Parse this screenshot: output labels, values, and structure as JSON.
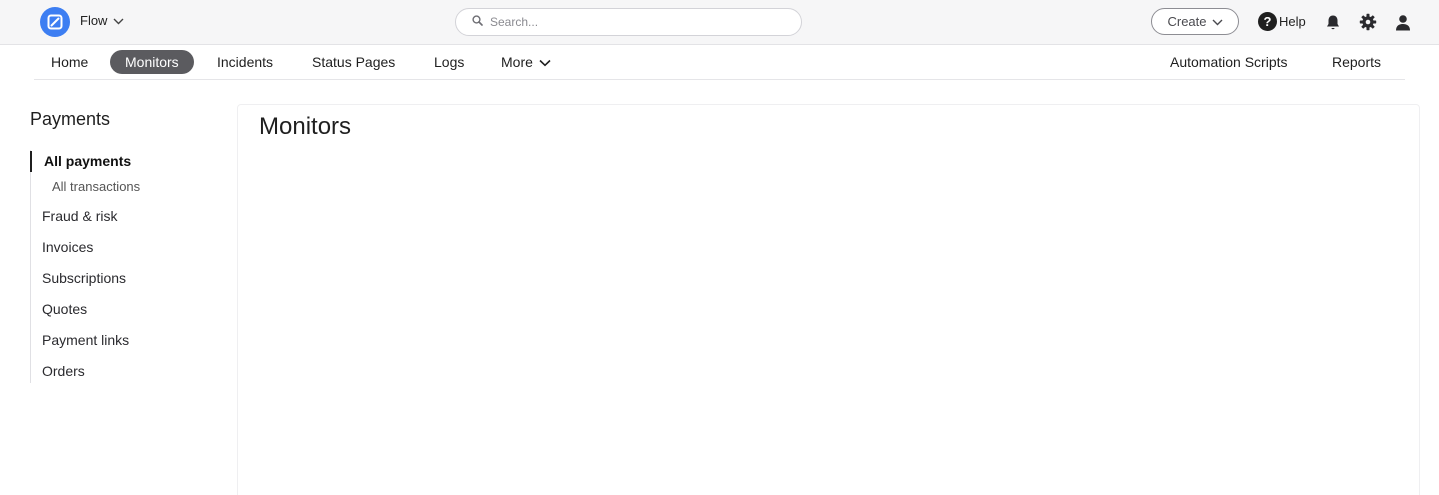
{
  "header": {
    "app_name": "Flow",
    "search_placeholder": "Search...",
    "create_label": "Create",
    "help_label": "Help",
    "help_glyph": "?"
  },
  "nav": {
    "items": [
      {
        "label": "Home"
      },
      {
        "label": "Monitors",
        "active": true
      },
      {
        "label": "Incidents"
      },
      {
        "label": "Status Pages"
      },
      {
        "label": "Logs"
      },
      {
        "label": "More"
      }
    ],
    "right_items": [
      {
        "label": "Automation Scripts"
      },
      {
        "label": "Reports"
      }
    ]
  },
  "sidebar": {
    "title": "Payments",
    "items": [
      {
        "label": "All payments",
        "active": true
      },
      {
        "label": "All transactions",
        "sub": true
      },
      {
        "label": "Fraud & risk"
      },
      {
        "label": "Invoices"
      },
      {
        "label": "Subscriptions"
      },
      {
        "label": "Quotes"
      },
      {
        "label": "Payment links"
      },
      {
        "label": "Orders"
      }
    ]
  },
  "main": {
    "title": "Monitors"
  },
  "colors": {
    "brand": "#3d7ef2",
    "active_tab_bg": "#5b5b5f",
    "topbar_bg": "#f6f6f7"
  },
  "icons": {
    "logo": "flow-logo-icon",
    "app_switch": "chevron-down-icon",
    "search": "search-icon",
    "create": "chevron-down-icon",
    "help": "help-circle-icon",
    "notifications": "bell-icon",
    "settings": "gear-icon",
    "account": "user-icon"
  }
}
